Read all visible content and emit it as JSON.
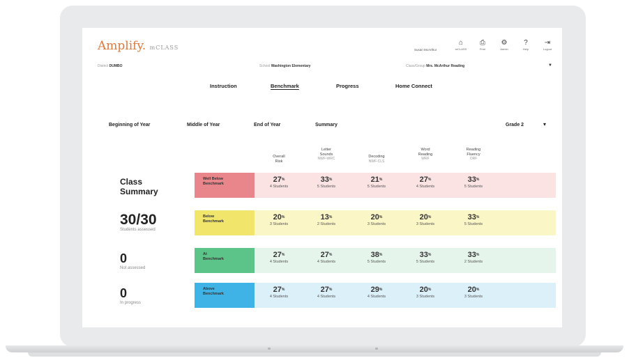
{
  "app": {
    "logo": "Amplify.",
    "product": "mCLASS"
  },
  "header": {
    "user": "Susan McArthur",
    "nav": [
      {
        "icon": "home-icon",
        "glyph": "⌂",
        "label": "mCLASS"
      },
      {
        "icon": "print-icon",
        "glyph": "⎙",
        "label": "Print"
      },
      {
        "icon": "admin-icon",
        "glyph": "⚙",
        "label": "Admin"
      },
      {
        "icon": "help-icon",
        "glyph": "?",
        "label": "Help"
      },
      {
        "icon": "logout-icon",
        "glyph": "⇥",
        "label": "Logout"
      }
    ]
  },
  "context": {
    "district_label": "District",
    "district": "DUMBO",
    "school_label": "School",
    "school": "Washington Elementary",
    "class_label": "Class/Group",
    "class": "Mrs. McArthur Reading"
  },
  "main_tabs": [
    "Instruction",
    "Benchmark",
    "Progress",
    "Home Connect"
  ],
  "period_tabs": [
    "Beginning of Year",
    "Middle of Year",
    "End of Year",
    "Summary"
  ],
  "grade": "Grade 2",
  "columns": [
    {
      "name": "Overall Risk",
      "l1": "Overall",
      "l2": "Risk",
      "l3": ""
    },
    {
      "name": "Letter Sounds",
      "l1": "Letter",
      "l2": "Sounds",
      "l3": "NWF-WRC"
    },
    {
      "name": "Decoding",
      "l1": "Decoding",
      "l2": "NWF-CLS",
      "l3": ""
    },
    {
      "name": "Word Reading",
      "l1": "Word",
      "l2": "Reading",
      "l3": "WRF"
    },
    {
      "name": "Reading Fluency",
      "l1": "Reading",
      "l2": "Fluency",
      "l3": "ORF"
    }
  ],
  "summary": {
    "title1": "Class",
    "title2": "Summary",
    "assessed": "30/30",
    "assessed_label": "Students assessed",
    "not_assessed": "0",
    "not_assessed_label": "Not assessed",
    "in_progress": "0",
    "in_progress_label": "In progress"
  },
  "rows": [
    {
      "l1": "Well Below",
      "l2": "Benchmark",
      "badge_color": "#e8868c",
      "row_color": "#fbe3e4",
      "cells": [
        {
          "pct": "27",
          "stu": "4 Students"
        },
        {
          "pct": "33",
          "stu": "5 Students"
        },
        {
          "pct": "21",
          "stu": "5 Students"
        },
        {
          "pct": "27",
          "stu": "4 Students"
        },
        {
          "pct": "33",
          "stu": "5 Students"
        }
      ]
    },
    {
      "l1": "Below",
      "l2": "Benchmark",
      "badge_color": "#f1e56c",
      "row_color": "#fbf6c6",
      "cells": [
        {
          "pct": "20",
          "stu": "3 Students"
        },
        {
          "pct": "13",
          "stu": "2 Students"
        },
        {
          "pct": "20",
          "stu": "3 Students"
        },
        {
          "pct": "20",
          "stu": "3 Students"
        },
        {
          "pct": "33",
          "stu": "5 Students"
        }
      ]
    },
    {
      "l1": "At",
      "l2": "Benchmark",
      "badge_color": "#5cc488",
      "row_color": "#e6f5ec",
      "cells": [
        {
          "pct": "27",
          "stu": "4 Students"
        },
        {
          "pct": "27",
          "stu": "4 Students"
        },
        {
          "pct": "38",
          "stu": "5 Students"
        },
        {
          "pct": "33",
          "stu": "5 Students"
        },
        {
          "pct": "33",
          "stu": "2 Students"
        }
      ]
    },
    {
      "l1": "Above",
      "l2": "Benchmark",
      "badge_color": "#3fb3e6",
      "row_color": "#dcf0fa",
      "cells": [
        {
          "pct": "27",
          "stu": "4 Students"
        },
        {
          "pct": "27",
          "stu": "4 Students"
        },
        {
          "pct": "29",
          "stu": "4 Students"
        },
        {
          "pct": "20",
          "stu": "3 Students"
        },
        {
          "pct": "20",
          "stu": "3 Students"
        }
      ]
    }
  ]
}
